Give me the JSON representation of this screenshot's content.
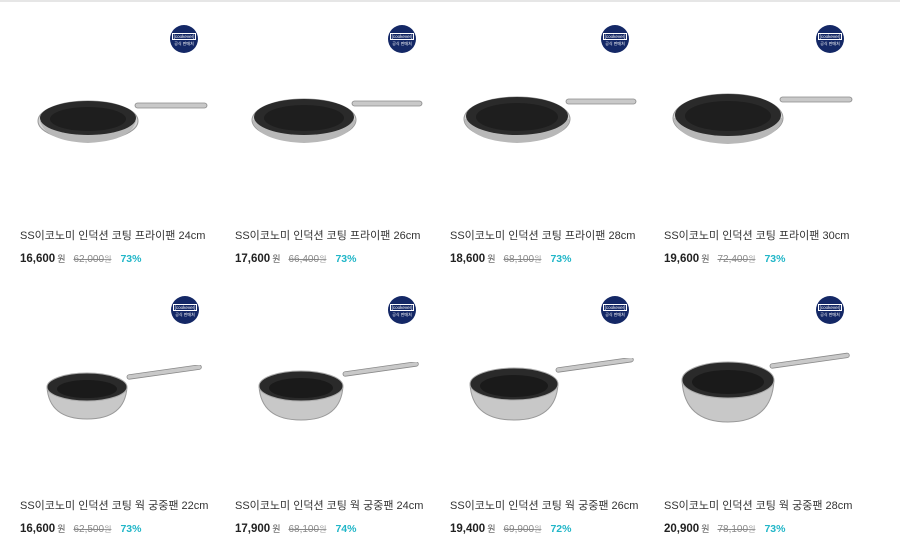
{
  "badge": {
    "brand": "[cookever]",
    "sub": "공식 판매처"
  },
  "accent_color": "#21b6c8",
  "badge_color": "#142866",
  "products": [
    {
      "name": "SS이코노미 인덕션 코팅 프라이팬 24cm",
      "price": "16,600",
      "currency": "원",
      "original": "62,000",
      "original_currency": "원",
      "discount": "73%",
      "type": "frypan"
    },
    {
      "name": "SS이코노미 인덕션 코팅 프라이팬 26cm",
      "price": "17,600",
      "currency": "원",
      "original": "66,400",
      "original_currency": "원",
      "discount": "73%",
      "type": "frypan"
    },
    {
      "name": "SS이코노미 인덕션 코팅 프라이팬 28cm",
      "price": "18,600",
      "currency": "원",
      "original": "68,100",
      "original_currency": "원",
      "discount": "73%",
      "type": "frypan"
    },
    {
      "name": "SS이코노미 인덕션 코팅 프라이팬 30cm",
      "price": "19,600",
      "currency": "원",
      "original": "72,400",
      "original_currency": "원",
      "discount": "73%",
      "type": "frypan"
    },
    {
      "name": "SS이코노미 인덕션 코팅 웍 궁중팬 22cm",
      "price": "16,600",
      "currency": "원",
      "original": "62,500",
      "original_currency": "원",
      "discount": "73%",
      "type": "wok"
    },
    {
      "name": "SS이코노미 인덕션 코팅 웍 궁중팬 24cm",
      "price": "17,900",
      "currency": "원",
      "original": "68,100",
      "original_currency": "원",
      "discount": "74%",
      "type": "wok"
    },
    {
      "name": "SS이코노미 인덕션 코팅 웍 궁중팬 26cm",
      "price": "19,400",
      "currency": "원",
      "original": "69,900",
      "original_currency": "원",
      "discount": "72%",
      "type": "wok"
    },
    {
      "name": "SS이코노미 인덕션 코팅 웍 궁중팬 28cm",
      "price": "20,900",
      "currency": "원",
      "original": "78,100",
      "original_currency": "원",
      "discount": "73%",
      "type": "wok"
    }
  ]
}
